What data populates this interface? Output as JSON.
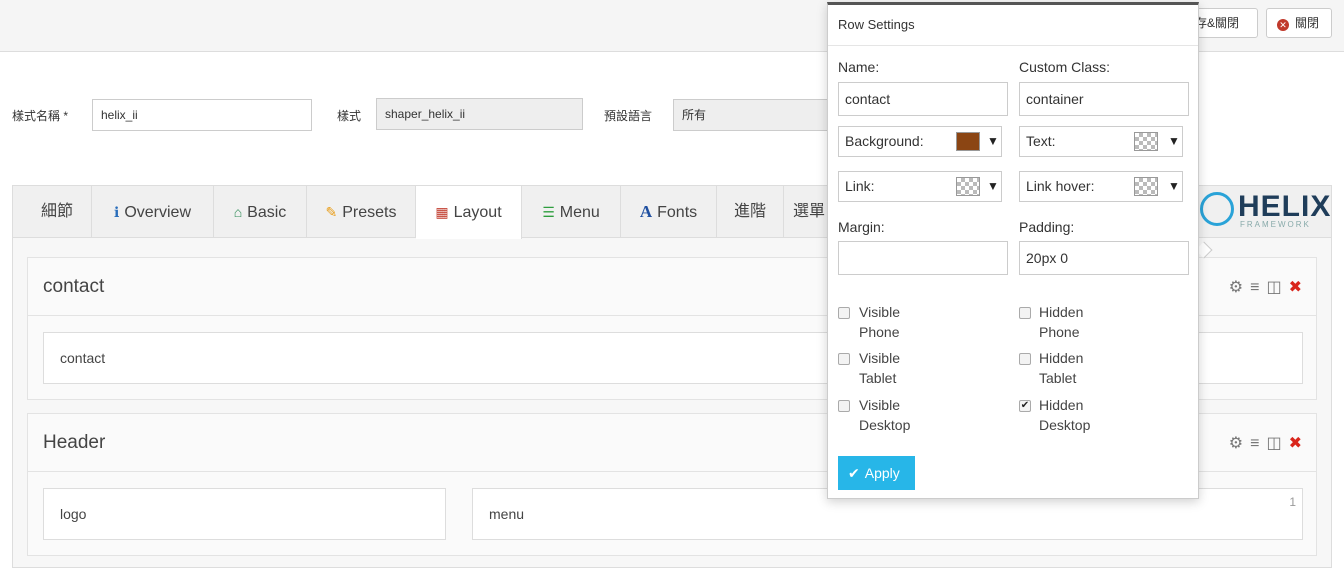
{
  "topbar": {
    "save_close_label": "儲存&關閉",
    "close_label": "關閉"
  },
  "form": {
    "style_name_label": "樣式名稱 *",
    "style_name_value": "helix_ii",
    "style_label": "樣式",
    "style_value": "shaper_helix_ii",
    "default_lang_label": "預設語言",
    "default_lang_value": "所有"
  },
  "tabs": [
    {
      "label": "細節",
      "icon": ""
    },
    {
      "label": "Overview",
      "icon": "info-icon"
    },
    {
      "label": "Basic",
      "icon": "home-icon"
    },
    {
      "label": "Presets",
      "icon": "pencil-icon"
    },
    {
      "label": "Layout",
      "icon": "grid-icon"
    },
    {
      "label": "Menu",
      "icon": "list-icon"
    },
    {
      "label": "Fonts",
      "icon": "font-icon"
    },
    {
      "label": "進階",
      "icon": ""
    },
    {
      "label": "選單",
      "icon": ""
    }
  ],
  "logo": {
    "text": "HELIX",
    "sub": "FRAMEWORK"
  },
  "rows": [
    {
      "title": "contact",
      "columns": [
        "contact"
      ]
    },
    {
      "title": "Header",
      "columns": [
        "logo",
        "menu"
      ],
      "column_badge": "1"
    }
  ],
  "popover": {
    "title": "Row Settings",
    "name_label": "Name:",
    "name_value": "contact",
    "custom_class_label": "Custom Class:",
    "custom_class_value": "container",
    "background_label": "Background:",
    "background_color": "#8b4513",
    "text_label": "Text:",
    "link_label": "Link:",
    "link_hover_label": "Link hover:",
    "margin_label": "Margin:",
    "margin_value": "",
    "padding_label": "Padding:",
    "padding_value": "20px 0",
    "checks": [
      {
        "label1": "Visible",
        "label2": "Phone",
        "checked": false
      },
      {
        "label1": "Hidden",
        "label2": "Phone",
        "checked": false
      },
      {
        "label1": "Visible",
        "label2": "Tablet",
        "checked": false
      },
      {
        "label1": "Hidden",
        "label2": "Tablet",
        "checked": false
      },
      {
        "label1": "Visible",
        "label2": "Desktop",
        "checked": false
      },
      {
        "label1": "Hidden",
        "label2": "Desktop",
        "checked": true
      }
    ],
    "apply_label": "Apply"
  },
  "colors": {
    "accent": "#27b6e8",
    "delete": "#d9261c",
    "tab_layout_icon": "#c0392b"
  }
}
